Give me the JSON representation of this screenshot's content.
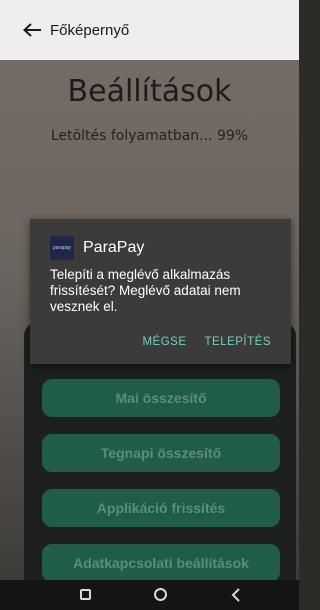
{
  "topbar": {
    "title": "Főképernyő",
    "back_icon": "arrow-left-icon"
  },
  "page": {
    "heading": "Beállítások",
    "progress_text": "Letöltés folyamatban... 99%"
  },
  "menu": {
    "items": [
      {
        "label": "Mai összesítő"
      },
      {
        "label": "Tegnapi összesítő"
      },
      {
        "label": "Applikáció frissítés"
      },
      {
        "label": "Adatkapcsolati beállítások"
      }
    ],
    "colors": {
      "button_bg": "#1f5c4a",
      "button_text": "#5d8c7c"
    }
  },
  "dialog": {
    "app_icon_text": "parapay",
    "app_name": "ParaPay",
    "message": "Telepíti a meglévő alkalmazás frissítését? Meglévő adatai nem vesznek el.",
    "cancel_label": "MÉGSE",
    "install_label": "TELEPÍTÉS",
    "accent_color": "#6fd1c0"
  },
  "navbar": {
    "icons": [
      "recent-apps-icon",
      "home-icon",
      "back-icon"
    ]
  }
}
